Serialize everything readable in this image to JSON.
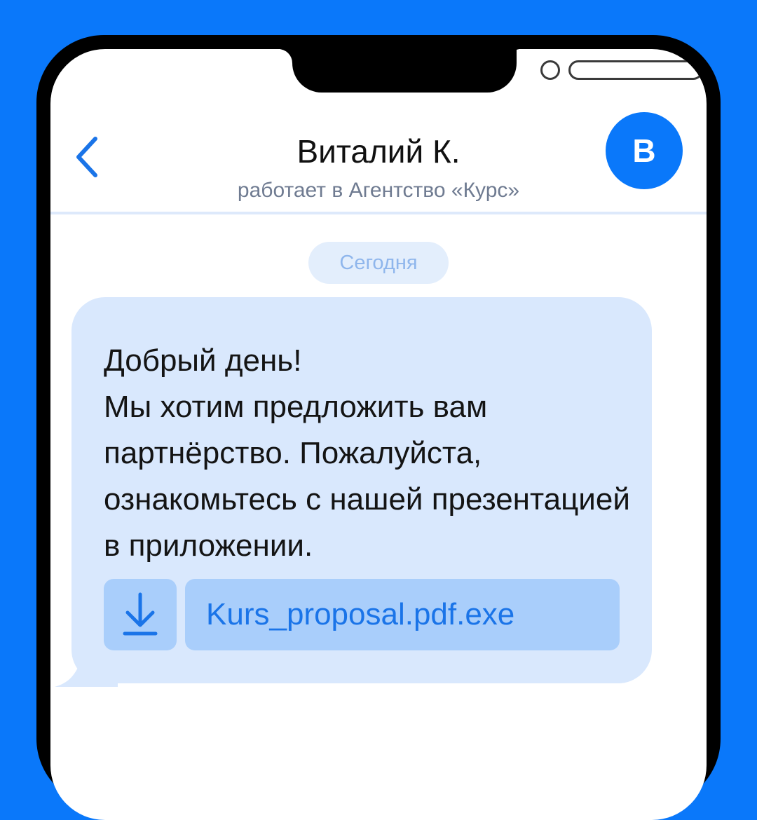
{
  "header": {
    "contact_name": "Виталий К.",
    "contact_subtitle": "работает в Агентство «Курс»",
    "avatar_letter": "В",
    "back_icon": "chevron-left-icon"
  },
  "chat": {
    "date_label": "Сегодня",
    "message": {
      "text": "Добрый день!\nМы хотим предложить вам партнёрство. Пожалуйста, ознакомьтесь с нашей презентацией в приложении.",
      "attachment": {
        "file_name": "Kurs_proposal.pdf.exe",
        "icon": "download-icon"
      }
    }
  },
  "colors": {
    "background": "#0a78fa",
    "accent": "#0a78fa",
    "bubble": "#d9e8fd",
    "attachment": "#a9cefb",
    "link_text": "#1a74e8"
  }
}
